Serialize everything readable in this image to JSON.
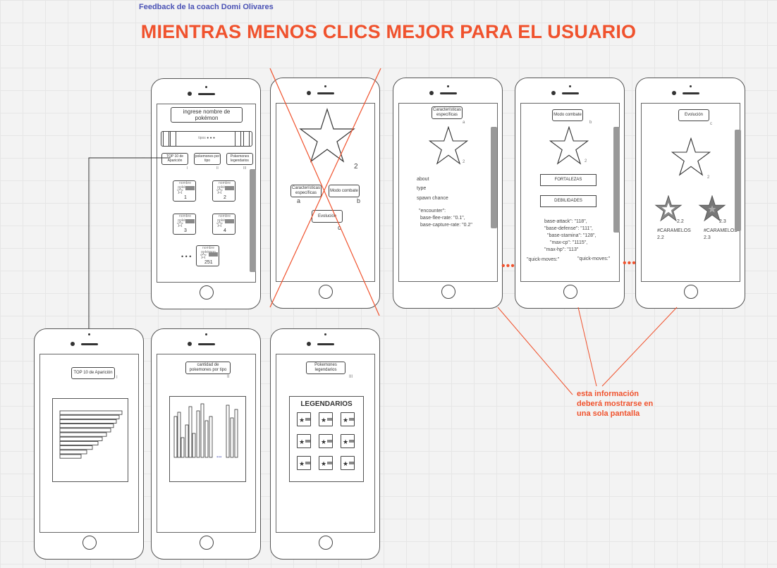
{
  "header": {
    "feedback": "Feedback de la coach Domi Olivares",
    "title": "MIENTRAS MENOS CLICS MEJOR PARA EL USUARIO"
  },
  "home": {
    "search_placeholder": "ingrese nombre de pokémon",
    "tipos": "tipos",
    "tipos_dots": "• • •",
    "ellipsis": "...",
    "btn_top": "TOP 10 de Aparición",
    "btn_types": "pokemones por tipo",
    "btn_legend": "Pokemones legendarios",
    "mark_i": "I",
    "mark_ii": "II",
    "mark_iii": "III",
    "card_1": "1",
    "card_2": "2",
    "card_3": "3",
    "card_4": "4",
    "card_251": "251",
    "card_small": "nombre pokémon",
    "more_dots": "• • •"
  },
  "crossed": {
    "num": "2",
    "btn_car": "Características específicas",
    "btn_modo": "Modo combate",
    "btn_evo": "Evolución",
    "mark_a": "a",
    "mark_b": "b",
    "mark_c": "c"
  },
  "screen_a": {
    "btn": "Características específicas",
    "mark": "a",
    "num": "2",
    "about": "about",
    "type": "type",
    "spawn": "spawn chance",
    "enc1": "\"encounter\":",
    "enc2": "base-flee-rate: \"0.1\",",
    "enc3": "base-capture-rate: \"0.2\""
  },
  "screen_b": {
    "btn": "Modo combate",
    "mark": "b",
    "num": "2",
    "fort": "FORTALEZAS",
    "deb": "DEBILIDADES",
    "s1": "base-attack\": \"118\",",
    "s2": "\"base-defense\": \"111\",",
    "s3": "\"base-stamina\": \"128\",",
    "s4": "\"max-cp\": \"1115\",",
    "s5": "\"max-hp\": \"113\"",
    "q1": "\"quick-moves:\"",
    "q2": "\"quick-moves:\""
  },
  "screen_c": {
    "btn": "Evolución",
    "mark": "c",
    "num": "2",
    "n1": "2.2",
    "n2": "2.3",
    "c1a": "#CARAMELOS",
    "c1b": "2.2",
    "c2a": "#CARAMELOS",
    "c2b": "2.3"
  },
  "screen_top": {
    "btn": "TOP 10 de Aparición",
    "mark": "I"
  },
  "screen_types": {
    "btn": "cantidad de pokemones por tipo",
    "mark": "II",
    "dots": "..."
  },
  "screen_leg": {
    "btn": "Pokemones legendarios",
    "mark": "III",
    "heading": "LEGENDARIOS"
  },
  "connector_dots": "•••",
  "note": {
    "l1": "esta información",
    "l2": "deberá mostrarse en",
    "l3": "una sola pantalla"
  },
  "colors": {
    "accent": "#f0522d",
    "feedback": "#4a52b5"
  }
}
